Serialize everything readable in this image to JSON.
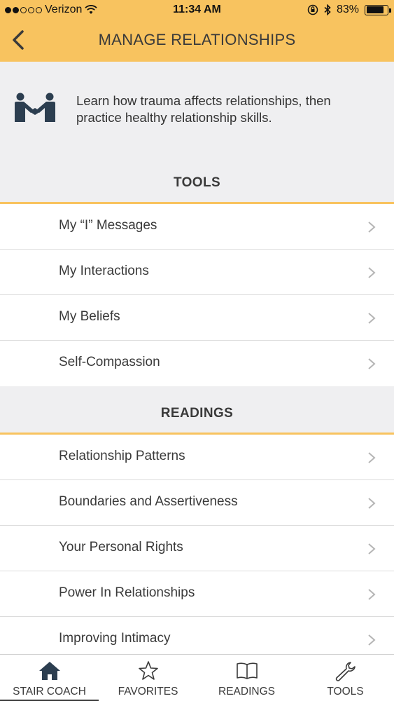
{
  "status_bar": {
    "carrier": "Verizon",
    "time": "11:34 AM",
    "battery_percent": "83%",
    "battery_level": 0.83,
    "signal_bars_filled": 2,
    "signal_bars_total": 5
  },
  "header": {
    "title": "MANAGE RELATIONSHIPS",
    "back_icon": "chevron-left-icon"
  },
  "intro": {
    "icon": "handshake-icon",
    "text_line1": "Learn how trauma affects relationships, then",
    "text_line2": "practice healthy relationship skills."
  },
  "tools_section": {
    "title": "TOOLS",
    "items": [
      {
        "label": "My “I” Messages"
      },
      {
        "label": "My Interactions"
      },
      {
        "label": "My Beliefs"
      },
      {
        "label": "Self-Compassion"
      }
    ]
  },
  "readings_section": {
    "title": "READINGS",
    "items": [
      {
        "label": "Relationship Patterns"
      },
      {
        "label": "Boundaries and Assertiveness"
      },
      {
        "label": "Your Personal Rights"
      },
      {
        "label": "Power In Relationships"
      },
      {
        "label": "Improving Intimacy"
      }
    ]
  },
  "tabbar": {
    "tabs": [
      {
        "label": "STAIR COACH",
        "icon": "home-icon",
        "active": true
      },
      {
        "label": "FAVORITES",
        "icon": "star-icon",
        "active": false
      },
      {
        "label": "READINGS",
        "icon": "book-icon",
        "active": false
      },
      {
        "label": "TOOLS",
        "icon": "wrench-icon",
        "active": false
      }
    ]
  },
  "colors": {
    "accent": "#f8c35f",
    "background": "#efeff1",
    "text": "#3a3a3a"
  }
}
